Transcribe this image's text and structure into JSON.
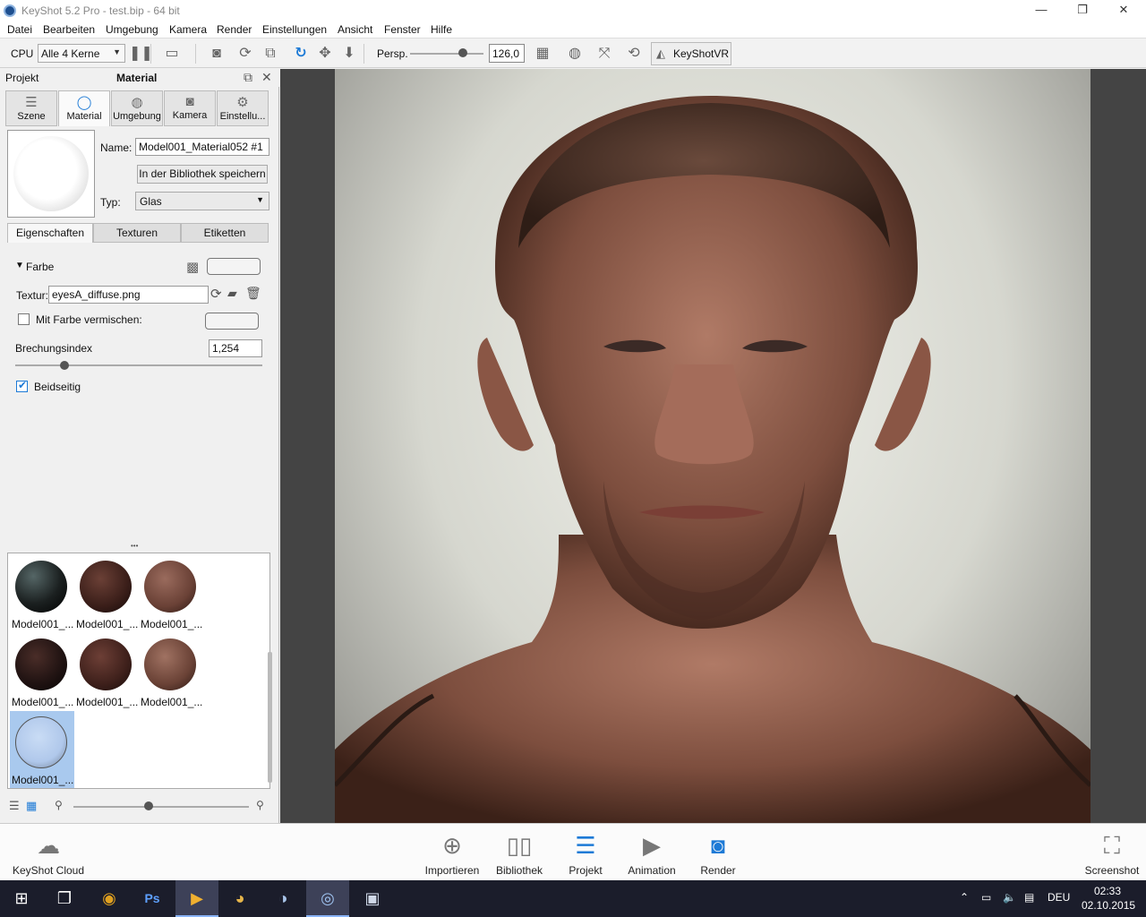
{
  "window": {
    "title": "KeyShot 5.2 Pro  -  test.bip  -  64 bit",
    "min": "—",
    "max": "❐",
    "close": "✕"
  },
  "menu": [
    "Datei",
    "Bearbeiten",
    "Umgebung",
    "Kamera",
    "Render",
    "Einstellungen",
    "Ansicht",
    "Fenster",
    "Hilfe"
  ],
  "toolbar": {
    "cpu_label": "CPU",
    "cpu_value": "Alle 4 Kerne",
    "persp_label": "Persp.",
    "fov_value": "126,0",
    "vr_label": "KeyShotVR",
    "fov_slider_fraction": 0.72
  },
  "panel": {
    "project_label": "Projekt",
    "title": "Material",
    "tabs": [
      "Szene",
      "Material",
      "Umgebung",
      "Kamera",
      "Einstellu..."
    ],
    "name_label": "Name:",
    "name_value": "Model001_Material052 #1",
    "save_button": "In der Bibliothek speichern",
    "type_label": "Typ:",
    "type_value": "Glas",
    "subtabs": [
      "Eigenschaften",
      "Texturen",
      "Etiketten"
    ],
    "color_section": "Farbe",
    "texture_label": "Textur:",
    "texture_value": "eyesA_diffuse.png",
    "mix_label": "Mit Farbe vermischen:",
    "refraction_label": "Brechungsindex",
    "refraction_value": "1,254",
    "refraction_slider_fraction": 0.2,
    "twosided_label": "Beidseitig",
    "more_dots": "•••",
    "library_items": [
      "Model001_...",
      "Model001_...",
      "Model001_...",
      "Model001_...",
      "Model001_...",
      "Model001_...",
      "Model001_..."
    ],
    "library_zoom_fraction": 0.43
  },
  "ribbon": {
    "cloud": "KeyShot Cloud",
    "import": "Importieren",
    "library": "Bibliothek",
    "project": "Projekt",
    "animation": "Animation",
    "render": "Render",
    "screenshot": "Screenshot"
  },
  "taskbar": {
    "lang": "DEU",
    "time": "02:33",
    "date": "02.10.2015"
  },
  "colors": {
    "accent": "#1d7ad6",
    "taskbar": "#1b1d2b",
    "viewport_bg": "#444444"
  }
}
